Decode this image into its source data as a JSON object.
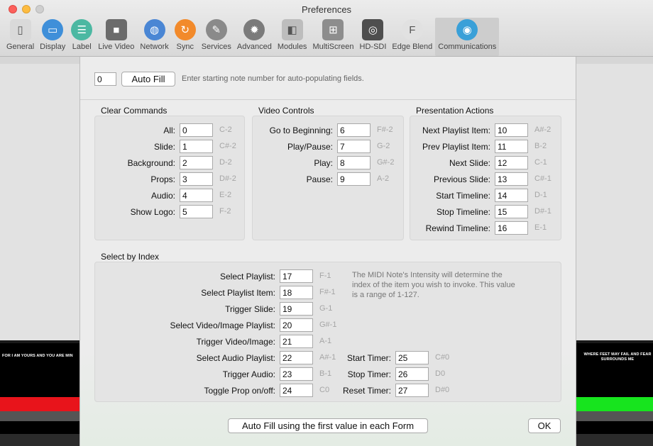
{
  "window": {
    "title": "Preferences"
  },
  "toolbar": [
    {
      "label": "General",
      "icon": "general-icon",
      "color": "#d9d9d9"
    },
    {
      "label": "Display",
      "icon": "display-icon",
      "color": "#3f8fd9"
    },
    {
      "label": "Label",
      "icon": "label-icon",
      "color": "#4cb8a2"
    },
    {
      "label": "Live Video",
      "icon": "video-camera-icon",
      "color": "#6b6b6b"
    },
    {
      "label": "Network",
      "icon": "globe-icon",
      "color": "#4a86d4"
    },
    {
      "label": "Sync",
      "icon": "sync-icon",
      "color": "#f28a2b"
    },
    {
      "label": "Services",
      "icon": "wrench-icon",
      "color": "#8a8a8a"
    },
    {
      "label": "Advanced",
      "icon": "gear-icon",
      "color": "#7b7b7b"
    },
    {
      "label": "Modules",
      "icon": "cube-icon",
      "color": "#bdbdbd"
    },
    {
      "label": "MultiScreen",
      "icon": "multiscreen-icon",
      "color": "#8d8d8d"
    },
    {
      "label": "HD-SDI",
      "icon": "sdi-icon",
      "color": "#4e4e4e"
    },
    {
      "label": "Edge Blend",
      "icon": "edge-blend-icon",
      "color": "#e1e1e1"
    },
    {
      "label": "Communications",
      "icon": "antenna-icon",
      "color": "#3aa0d8"
    }
  ],
  "autofill": {
    "value": "0",
    "button": "Auto Fill",
    "hint": "Enter starting note number for auto-populating fields."
  },
  "clear": {
    "title": "Clear Commands",
    "rows": [
      {
        "label": "All:",
        "value": "0",
        "note": "C-2"
      },
      {
        "label": "Slide:",
        "value": "1",
        "note": "C#-2"
      },
      {
        "label": "Background:",
        "value": "2",
        "note": "D-2"
      },
      {
        "label": "Props:",
        "value": "3",
        "note": "D#-2"
      },
      {
        "label": "Audio:",
        "value": "4",
        "note": "E-2"
      },
      {
        "label": "Show Logo:",
        "value": "5",
        "note": "F-2"
      }
    ]
  },
  "video": {
    "title": "Video Controls",
    "rows": [
      {
        "label": "Go to Beginning:",
        "value": "6",
        "note": "F#-2"
      },
      {
        "label": "Play/Pause:",
        "value": "7",
        "note": "G-2"
      },
      {
        "label": "Play:",
        "value": "8",
        "note": "G#-2"
      },
      {
        "label": "Pause:",
        "value": "9",
        "note": "A-2"
      }
    ]
  },
  "presentation": {
    "title": "Presentation Actions",
    "rows": [
      {
        "label": "Next Playlist Item:",
        "value": "10",
        "note": "A#-2"
      },
      {
        "label": "Prev Playlist Item:",
        "value": "11",
        "note": "B-2"
      },
      {
        "label": "Next Slide:",
        "value": "12",
        "note": "C-1"
      },
      {
        "label": "Previous Slide:",
        "value": "13",
        "note": "C#-1"
      },
      {
        "label": "Start Timeline:",
        "value": "14",
        "note": "D-1"
      },
      {
        "label": "Stop Timeline:",
        "value": "15",
        "note": "D#-1"
      },
      {
        "label": "Rewind Timeline:",
        "value": "16",
        "note": "E-1"
      }
    ]
  },
  "index": {
    "title": "Select by Index",
    "info": "The MIDI Note's Intensity will determine the index of the item you wish to invoke. This value is a range of 1-127.",
    "rows": [
      {
        "label": "Select Playlist:",
        "value": "17",
        "note": "F-1"
      },
      {
        "label": "Select Playlist Item:",
        "value": "18",
        "note": "F#-1"
      },
      {
        "label": "Trigger Slide:",
        "value": "19",
        "note": "G-1"
      },
      {
        "label": "Select Video/Image Playlist:",
        "value": "20",
        "note": "G#-1"
      },
      {
        "label": "Trigger Video/Image:",
        "value": "21",
        "note": "A-1"
      },
      {
        "label": "Select Audio Playlist:",
        "value": "22",
        "note": "A#-1"
      },
      {
        "label": "Trigger Audio:",
        "value": "23",
        "note": "B-1"
      },
      {
        "label": "Toggle Prop on/off:",
        "value": "24",
        "note": "C0"
      }
    ],
    "timers": [
      {
        "label": "Start Timer:",
        "value": "25",
        "note": "C#0"
      },
      {
        "label": "Stop Timer:",
        "value": "26",
        "note": "D0"
      },
      {
        "label": "Reset Timer:",
        "value": "27",
        "note": "D#0"
      }
    ]
  },
  "footer": {
    "autofill_all": "Auto Fill using the first value in each Form",
    "ok": "OK"
  },
  "background": {
    "left_text": "FOR I AM YOURS AND YOU ARE MIN",
    "right_text": "WHERE FEET MAY FAIL AND FEAR SURROUNDS ME"
  }
}
